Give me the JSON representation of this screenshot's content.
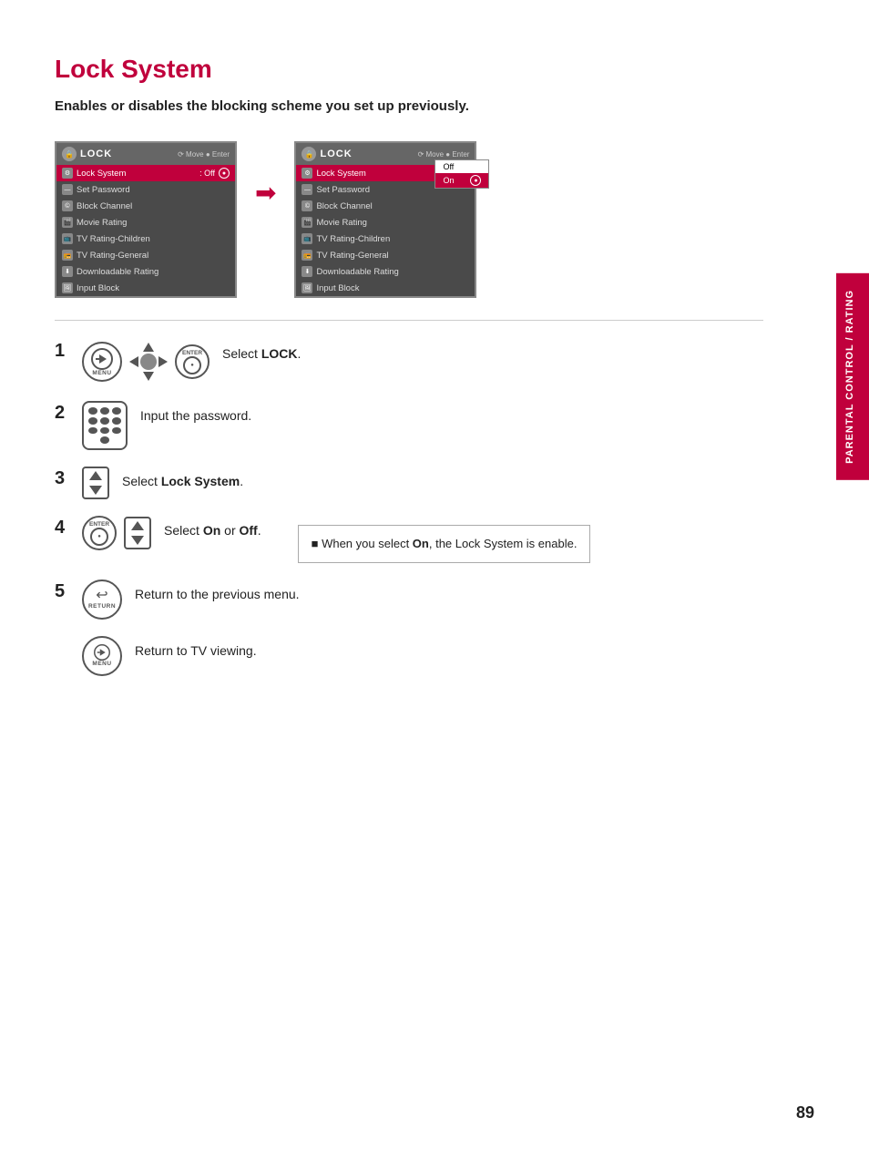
{
  "page": {
    "title": "Lock System",
    "subtitle": "Enables or disables the blocking scheme you set up previously.",
    "page_number": "89",
    "sidebar_label": "PARENTAL CONTROL / RATING"
  },
  "left_menu": {
    "header": "LOCK",
    "nav_hint_move": "Move",
    "nav_hint_enter": "Enter",
    "rows": [
      {
        "label": "Lock System",
        "value": ": Off",
        "selected": true
      },
      {
        "label": "Set Password",
        "value": ""
      },
      {
        "label": "Block Channel",
        "value": ""
      },
      {
        "label": "Movie Rating",
        "value": ""
      },
      {
        "label": "TV Rating-Children",
        "value": ""
      },
      {
        "label": "TV Rating-General",
        "value": ""
      },
      {
        "label": "Downloadable Rating",
        "value": ""
      },
      {
        "label": "Input Block",
        "value": ""
      }
    ]
  },
  "right_menu": {
    "header": "LOCK",
    "nav_hint_move": "Move",
    "nav_hint_enter": "Enter",
    "rows": [
      {
        "label": "Lock System",
        "value": ": On",
        "selected": true
      },
      {
        "label": "Set Password",
        "value": ""
      },
      {
        "label": "Block Channel",
        "value": ""
      },
      {
        "label": "Movie Rating",
        "value": ""
      },
      {
        "label": "TV Rating-Children",
        "value": ""
      },
      {
        "label": "TV Rating-General",
        "value": ""
      },
      {
        "label": "Downloadable Rating",
        "value": ""
      },
      {
        "label": "Input Block",
        "value": ""
      }
    ],
    "dropdown": {
      "items": [
        "Off",
        "On"
      ],
      "selected": "On"
    }
  },
  "steps": [
    {
      "number": "1",
      "text": "Select LOCK.",
      "bold_part": "LOCK"
    },
    {
      "number": "2",
      "text": "Input the password.",
      "bold_part": ""
    },
    {
      "number": "3",
      "text": "Select Lock System.",
      "bold_part": "Lock System"
    },
    {
      "number": "4",
      "text": "Select On or Off.",
      "bold_part_on": "On",
      "bold_part_off": "Off"
    },
    {
      "number": "5",
      "text": "Return to the previous menu.",
      "bold_part": ""
    },
    {
      "number": "",
      "text": "Return to TV viewing.",
      "bold_part": ""
    }
  ],
  "info_box": {
    "text": "When you select On, the Lock System is enable.",
    "bold_part": "On"
  }
}
